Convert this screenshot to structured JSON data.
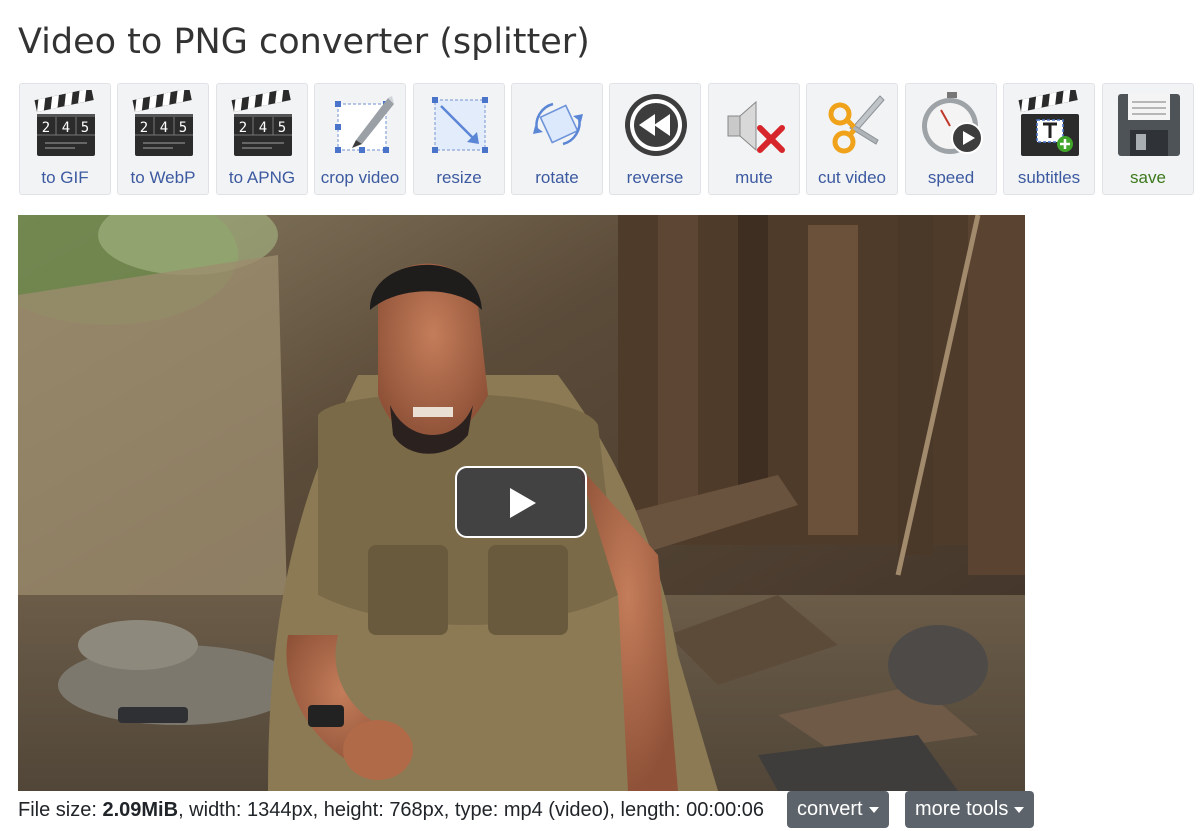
{
  "page": {
    "title": "Video to PNG converter (splitter)"
  },
  "toolbar": {
    "items": [
      {
        "label": "to GIF",
        "icon": "clapperboard-icon"
      },
      {
        "label": "to WebP",
        "icon": "clapperboard-icon"
      },
      {
        "label": "to APNG",
        "icon": "clapperboard-icon"
      },
      {
        "label": "crop video",
        "icon": "crop-icon"
      },
      {
        "label": "resize",
        "icon": "resize-icon"
      },
      {
        "label": "rotate",
        "icon": "rotate-icon"
      },
      {
        "label": "reverse",
        "icon": "rewind-icon"
      },
      {
        "label": "mute",
        "icon": "mute-speaker-icon"
      },
      {
        "label": "cut video",
        "icon": "scissors-icon"
      },
      {
        "label": "speed",
        "icon": "stopwatch-icon"
      },
      {
        "label": "subtitles",
        "icon": "subtitles-clapperboard-icon"
      },
      {
        "label": "save",
        "icon": "floppy-disk-icon"
      }
    ],
    "clapper_digits": [
      "2",
      "4",
      "5"
    ]
  },
  "player": {
    "play_icon": "play-icon"
  },
  "file_info": {
    "size_label": "File size: ",
    "size_value": "2.09MiB",
    "rest": ", width: 1344px, height: 768px, type: mp4 (video), length: 00:00:06"
  },
  "actions": {
    "convert_label": "convert",
    "more_tools_label": "more tools"
  },
  "colors": {
    "tool_label": "#3c5aa0",
    "save_label": "#3c7a1c",
    "dropdown_bg": "#5c636a"
  }
}
